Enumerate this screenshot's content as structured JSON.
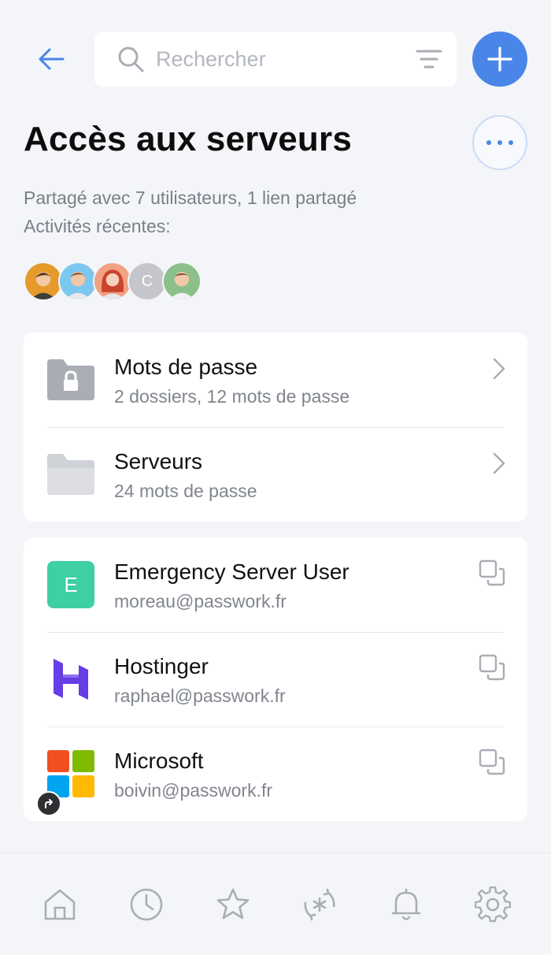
{
  "search": {
    "placeholder": "Rechercher"
  },
  "page": {
    "title": "Accès aux serveurs",
    "shared_info": "Partagé avec 7 utilisateurs, 1 lien partagé",
    "recent_activity_label": "Activités récentes:"
  },
  "avatars": [
    {
      "kind": "photo",
      "bg": "#e59a2b"
    },
    {
      "kind": "photo",
      "bg": "#7cc7ee"
    },
    {
      "kind": "photo",
      "bg": "#e45b3b"
    },
    {
      "kind": "letter",
      "letter": "C",
      "bg": "#c4c6cb"
    },
    {
      "kind": "photo",
      "bg": "#8cc08a"
    }
  ],
  "folders": [
    {
      "title": "Mots de passe",
      "subtitle": "2 dossiers, 12 mots de passe",
      "icon": "locked-folder-icon"
    },
    {
      "title": "Serveurs",
      "subtitle": "24 mots de passe",
      "icon": "folder-icon"
    }
  ],
  "passwords": [
    {
      "title": "Emergency Server User",
      "subtitle": "moreau@passwork.fr",
      "icon": "letter-icon",
      "icon_letter": "E",
      "icon_color": "#3ecfa2"
    },
    {
      "title": "Hostinger",
      "subtitle": "raphael@passwork.fr",
      "icon": "hostinger-logo-icon",
      "icon_color": "#673de6"
    },
    {
      "title": "Microsoft",
      "subtitle": "boivin@passwork.fr",
      "icon": "microsoft-logo-icon",
      "shared": true
    }
  ],
  "tabs": [
    "home-icon",
    "history-icon",
    "favorites-star-icon",
    "password-generator-icon",
    "notifications-bell-icon",
    "settings-gear-icon"
  ],
  "colors": {
    "accent": "#4a86e8",
    "background": "#f4f5f8",
    "muted_text": "#7a7f88",
    "icon_gray": "#a9adb4"
  }
}
